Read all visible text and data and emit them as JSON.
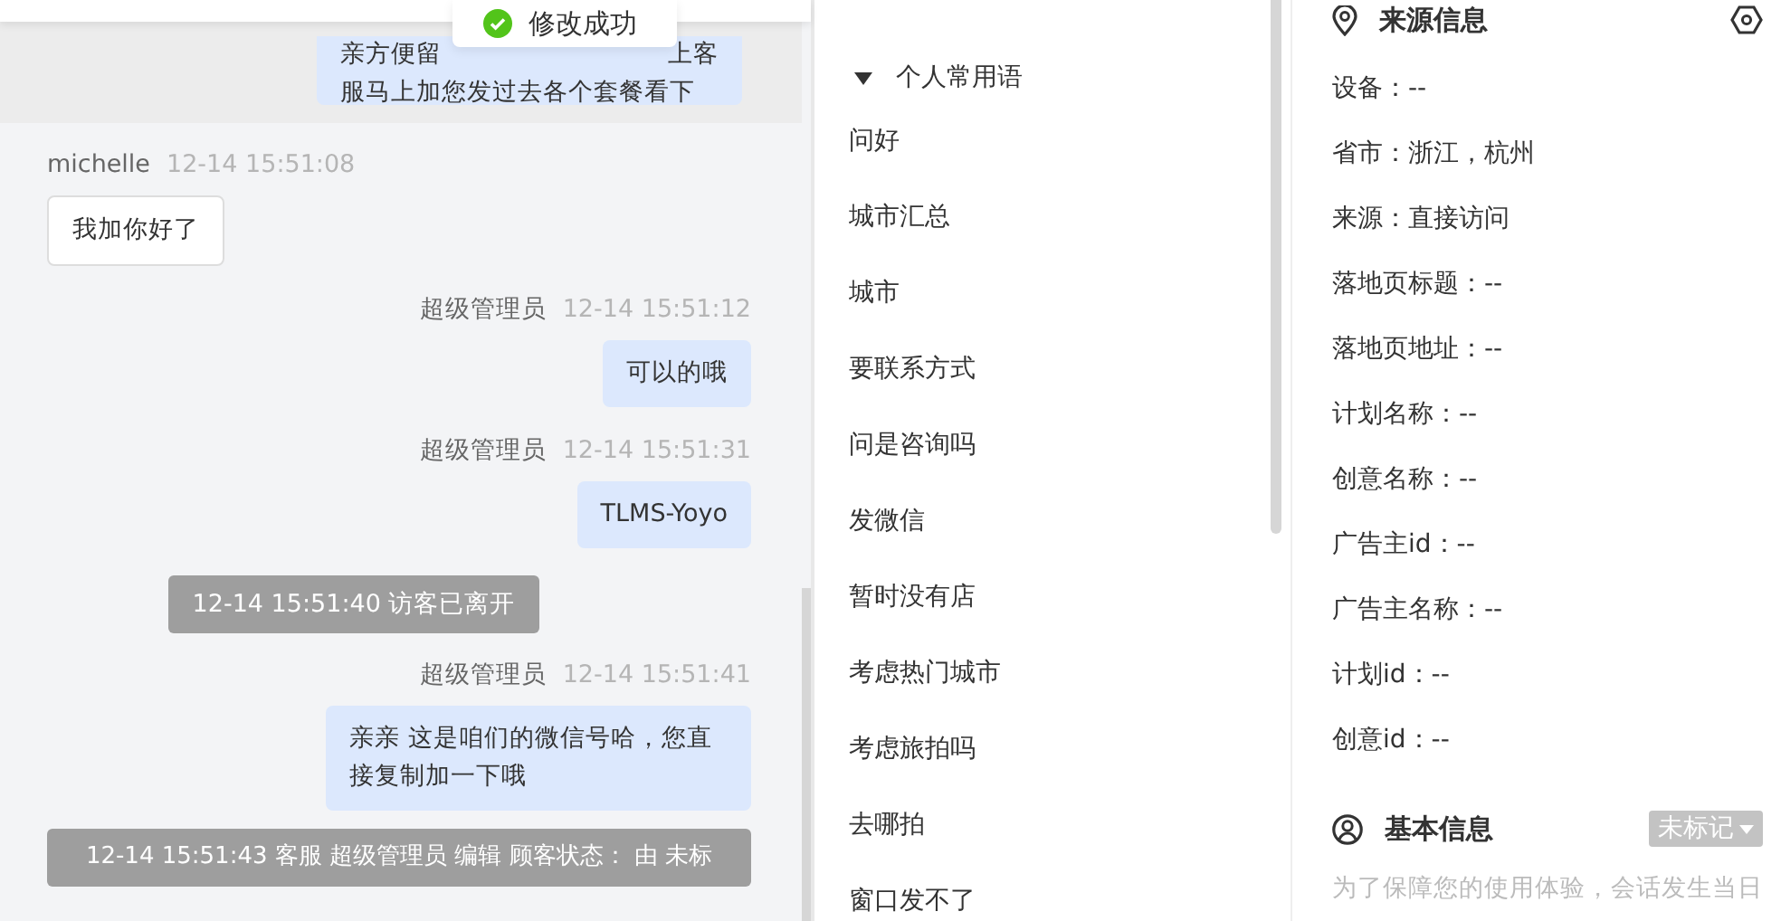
{
  "toast": {
    "text": "修改成功"
  },
  "clipped_message": {
    "line_parts": [
      "亲方便留",
      "上客"
    ],
    "line_2": "服马上加您发过去各个套餐看下"
  },
  "messages": [
    {
      "kind": "visitor",
      "sender": "michelle",
      "time": "12-14 15:51:08",
      "text": "我加你好了"
    },
    {
      "kind": "agent",
      "sender": "超级管理员",
      "time": "12-14 15:51:12",
      "text": "可以的哦"
    },
    {
      "kind": "agent",
      "sender": "超级管理员",
      "time": "12-14 15:51:31",
      "text": "TLMS-Yoyo"
    },
    {
      "kind": "system",
      "text": "12-14 15:51:40 访客已离开"
    },
    {
      "kind": "agent",
      "sender": "超级管理员",
      "time": "12-14 15:51:41",
      "text": "亲亲 这是咱们的微信号哈，您直接复制加一下哦"
    },
    {
      "kind": "system_wide",
      "text": "12-14 15:51:43 客服 超级管理员 编辑 顾客状态： 由 未标"
    }
  ],
  "phrases": {
    "category": {
      "label": "个人常用语",
      "expanded": true
    },
    "items": [
      "问好",
      "城市汇总",
      "城市",
      "要联系方式",
      "问是咨询吗",
      "发微信",
      "暂时没有店",
      "考虑热门城市",
      "考虑旅拍吗",
      "去哪拍",
      "窗口发不了"
    ]
  },
  "source_info": {
    "title": "来源信息",
    "items": [
      "设备：--",
      "省市：浙江，杭州",
      "来源：直接访问",
      "落地页标题：--",
      "落地页地址：--",
      "计划名称：--",
      "创意名称：--",
      "广告主id：--",
      "广告主名称：--",
      "计划id：--",
      "创意id：--"
    ]
  },
  "basic_info": {
    "title": "基本信息",
    "tag": "未标记",
    "note": "为了保障您的使用体验，会话发生当日"
  }
}
